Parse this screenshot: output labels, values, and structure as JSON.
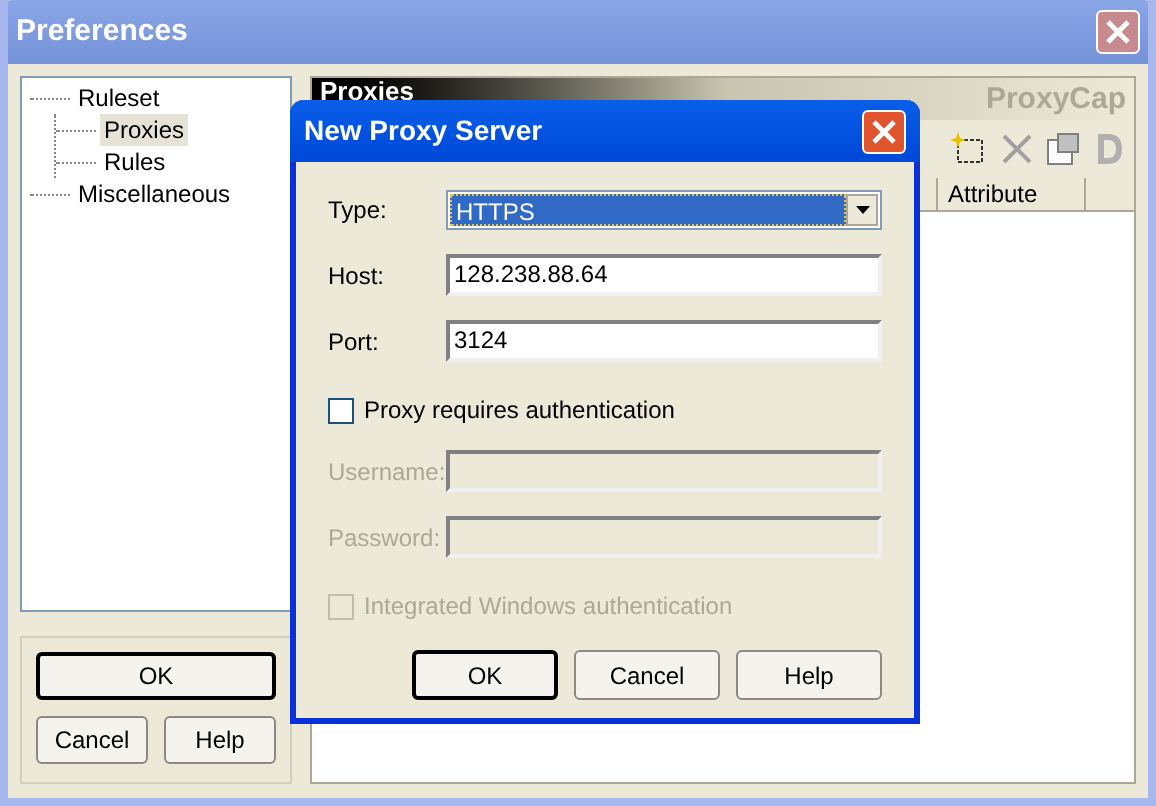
{
  "window": {
    "title": "Preferences"
  },
  "tree": [
    {
      "label": "Ruleset",
      "selected": false,
      "children": [
        {
          "label": "Proxies",
          "selected": true
        },
        {
          "label": "Rules",
          "selected": false
        }
      ]
    },
    {
      "label": "Miscellaneous",
      "selected": false
    }
  ],
  "window_buttons": [
    {
      "label": "OK",
      "default": true
    },
    {
      "label": "Cancel",
      "default": false
    },
    {
      "label": "Help",
      "default": false
    }
  ],
  "panel": {
    "title": "Proxies",
    "brand": "ProxyCap",
    "columns": [
      "Attribute"
    ]
  },
  "dialog": {
    "title": "New Proxy Server",
    "fields": [
      {
        "kind": "combo",
        "label": "Type:",
        "value": "HTTPS",
        "disabled": false
      },
      {
        "kind": "text",
        "label": "Host:",
        "value": "128.238.88.64",
        "disabled": false
      },
      {
        "kind": "text",
        "label": "Port:",
        "value": "3124",
        "disabled": false
      },
      {
        "kind": "check",
        "label": "Proxy requires authentication",
        "checked": false,
        "disabled": false
      },
      {
        "kind": "text",
        "label": "Username:",
        "disabled": true
      },
      {
        "kind": "text",
        "label": "Password:",
        "disabled": true
      },
      {
        "kind": "check",
        "label": "Integrated Windows authentication",
        "checked": false,
        "disabled": true
      }
    ],
    "buttons": [
      {
        "label": "OK",
        "default": true
      },
      {
        "label": "Cancel",
        "default": false
      },
      {
        "label": "Help",
        "default": false
      }
    ]
  }
}
